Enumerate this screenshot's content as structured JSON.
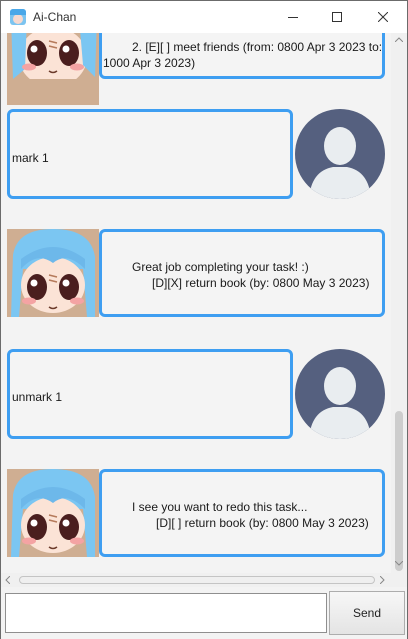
{
  "window": {
    "title": "Ai-Chan"
  },
  "messages": [
    {
      "sender": "bot",
      "lines": [
        "2. [E][ ] meet friends (from: 0800 Apr 3 2023 to:",
        "1000 Apr 3 2023)"
      ]
    },
    {
      "sender": "user",
      "lines": [
        "mark 1"
      ]
    },
    {
      "sender": "bot",
      "lines": [
        "Great job completing your task! :)",
        "[D][X] return book (by: 0800 May 3 2023)"
      ]
    },
    {
      "sender": "user",
      "lines": [
        "unmark 1"
      ]
    },
    {
      "sender": "bot",
      "lines": [
        "I see you want to redo this task...",
        "[D][ ] return book (by: 0800 May 3 2023)"
      ]
    }
  ],
  "input": {
    "value": "",
    "placeholder": ""
  },
  "send_button": {
    "label": "Send"
  },
  "colors": {
    "bubble_border": "#3e9ef1",
    "user_avatar_bg": "#55607f",
    "background": "#f3f3f3"
  }
}
